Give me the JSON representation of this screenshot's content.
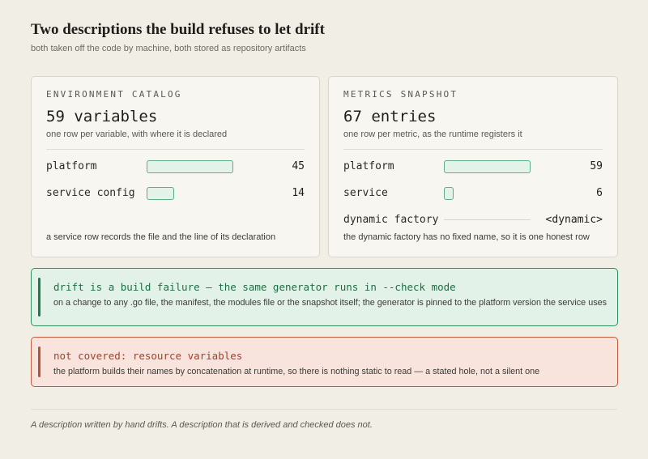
{
  "header": {
    "title": "Two descriptions the build refuses to let drift",
    "subtitle": "both taken off the code by machine, both stored as repository artifacts"
  },
  "env_card": {
    "kicker": "ENVIRONMENT CATALOG",
    "count": "59 variables",
    "description": "one row per variable, with where it is declared",
    "rows": [
      {
        "label": "platform",
        "value": "45"
      },
      {
        "label": "service config",
        "value": "14"
      }
    ],
    "footnote": "a service row records the file and the line of its declaration"
  },
  "metrics_card": {
    "kicker": "METRICS SNAPSHOT",
    "count": "67 entries",
    "description": "one row per metric, as the runtime registers it",
    "rows": [
      {
        "label": "platform",
        "value": "59"
      },
      {
        "label": "service",
        "value": "6"
      },
      {
        "label": "dynamic factory",
        "value": "<dynamic>"
      }
    ],
    "footnote": "the dynamic factory has no fixed name, so it is one honest row"
  },
  "drift_callout": {
    "heading": "drift is a build failure — the same generator runs in --check mode",
    "body": "on a change to any .go file, the manifest, the modules file or the snapshot itself; the generator is pinned to the platform version the service uses"
  },
  "gap_callout": {
    "heading": "not covered: resource variables",
    "body": "the platform builds their names by concatenation at runtime, so there is nothing static to read — a stated hole, not a silent one"
  },
  "tagline": "A description written by hand drifts. A description that is derived and checked does not.",
  "colors": {
    "accent_green": "#1f7a4d",
    "accent_red": "#b6553a",
    "bar_fill": "#e3f3ea",
    "bar_border": "#5cae85"
  }
}
